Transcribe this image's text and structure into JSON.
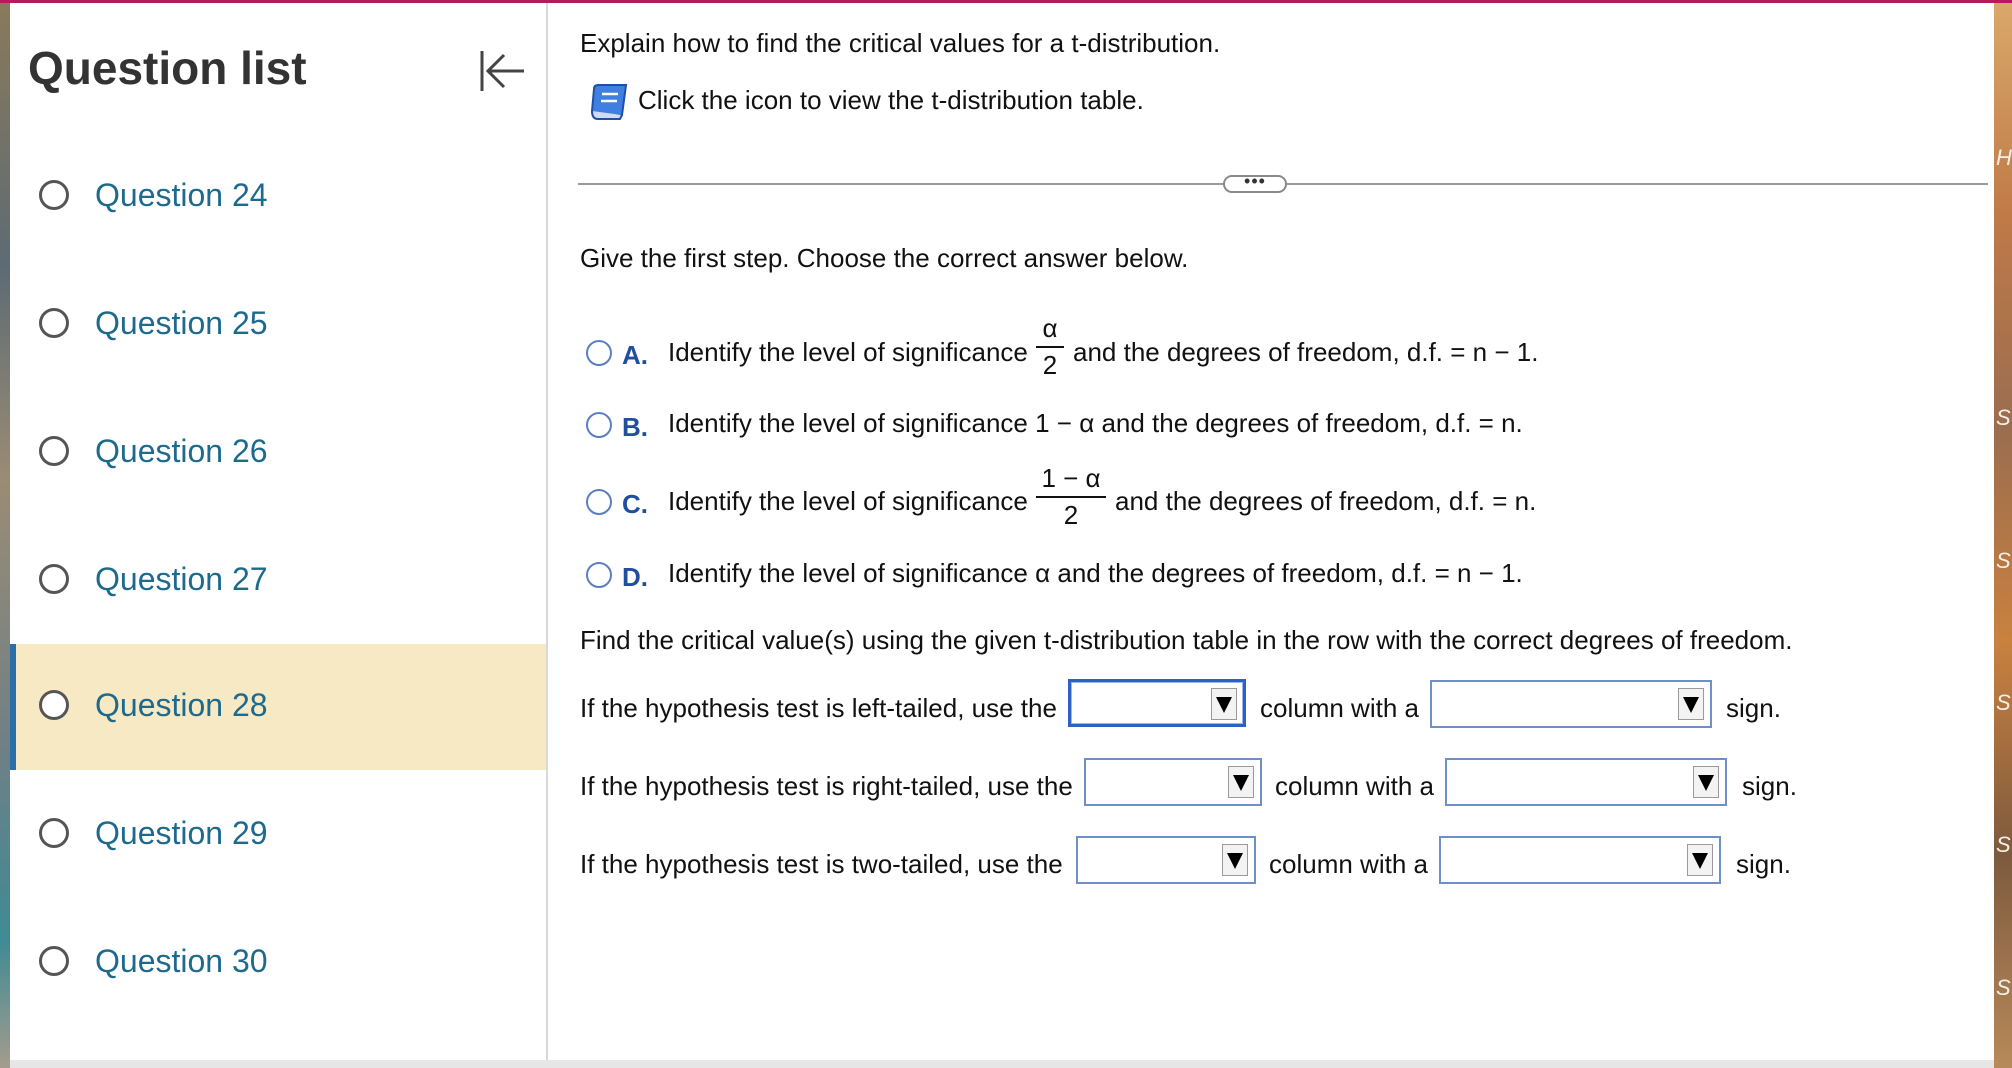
{
  "sidebar": {
    "title": "Question list",
    "collapse_icon": "collapse-left-arrow-icon",
    "items": [
      {
        "label": "Question 24",
        "selected": false
      },
      {
        "label": "Question 25",
        "selected": false
      },
      {
        "label": "Question 26",
        "selected": false
      },
      {
        "label": "Question 27",
        "selected": false
      },
      {
        "label": "Question 28",
        "selected": true
      },
      {
        "label": "Question 29",
        "selected": false
      },
      {
        "label": "Question 30",
        "selected": false
      }
    ]
  },
  "question": {
    "prompt": "Explain how to find the critical values for a t-distribution.",
    "table_hint": "Click the icon to view the t-distribution table.",
    "table_icon": "book-icon",
    "more_label": "•••",
    "step1_prompt": "Give the first step. Choose the correct answer below.",
    "options": [
      {
        "letter": "A.",
        "text_before": "Identify the level of significance",
        "frac_num": "α",
        "frac_den": "2",
        "text_after": "and the degrees of freedom, d.f. = n − 1."
      },
      {
        "letter": "B.",
        "text": "Identify the level of significance 1 − α and the degrees of freedom, d.f. = n."
      },
      {
        "letter": "C.",
        "text_before": "Identify the level of significance",
        "frac_num": "1 − α",
        "frac_den": "2",
        "text_after": "and the degrees of freedom, d.f. = n."
      },
      {
        "letter": "D.",
        "text": "Identify the level of significance α and the degrees of freedom, d.f. = n − 1."
      }
    ],
    "step2_prompt": "Find the critical value(s) using the given t-distribution table in the row with the correct degrees of freedom.",
    "rows": [
      {
        "prefix": "If the hypothesis test is left-tailed, use the",
        "middle": "column with a",
        "suffix": "sign.",
        "value1": "",
        "value2": ""
      },
      {
        "prefix": "If the hypothesis test is right-tailed, use the",
        "middle": "column with a",
        "suffix": "sign.",
        "value1": "",
        "value2": ""
      },
      {
        "prefix": "If the hypothesis test is two-tailed, use the",
        "middle": "column with a",
        "suffix": "sign.",
        "value1": "",
        "value2": ""
      }
    ]
  },
  "colors": {
    "accent_top": "#b21b5d",
    "link_blue": "#1d6a8e",
    "selected_bg": "#f7e9c3",
    "option_letter": "#1f4f9e"
  }
}
